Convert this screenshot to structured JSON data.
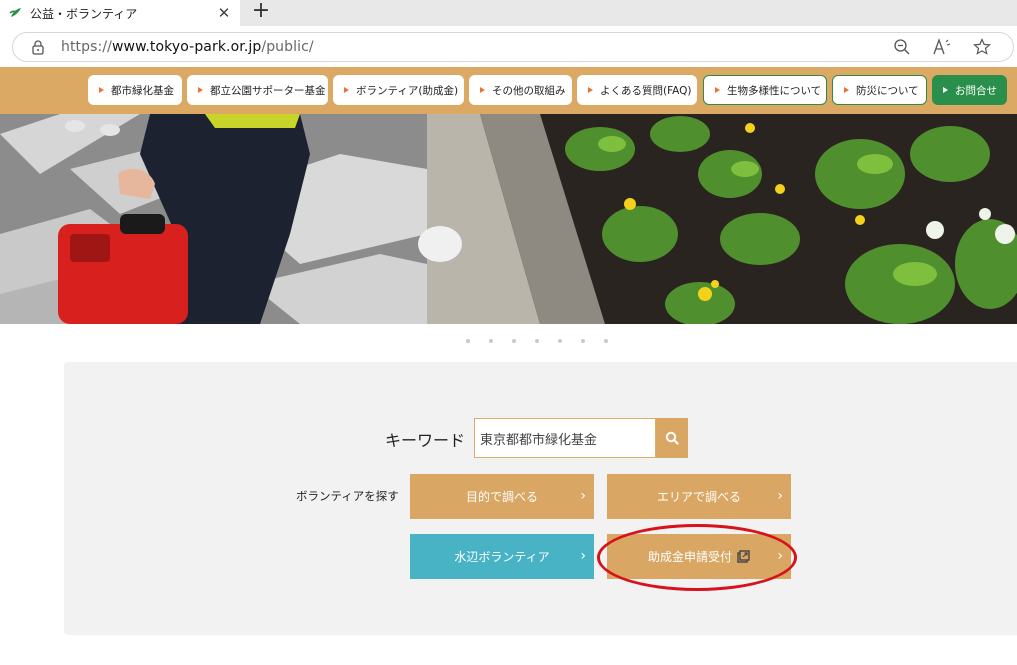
{
  "browser": {
    "tab_title": "公益・ボランティア",
    "tab_close": "✕",
    "new_tab": "+",
    "url_prefix": "https://",
    "url_host": "www.tokyo-park.or.jp",
    "url_path": "/public/",
    "icons": [
      "lock-icon",
      "zoom-out-icon",
      "read-aloud-icon",
      "favorite-star-icon"
    ]
  },
  "nav": {
    "items": [
      {
        "label": "都市緑化基金",
        "style": "white"
      },
      {
        "label": "都立公園サポーター基金",
        "style": "white"
      },
      {
        "label": "ボランティア(助成金)",
        "style": "white"
      },
      {
        "label": "その他の取組み",
        "style": "white"
      },
      {
        "label": "よくある質問(FAQ)",
        "style": "white"
      },
      {
        "label": "生物多様性について",
        "style": "outline-green"
      },
      {
        "label": "防災について",
        "style": "outline-green"
      },
      {
        "label": "お問合せ",
        "style": "green"
      }
    ],
    "colors": {
      "bar": "#dca965",
      "accent_green": "#2a8f4a",
      "triangle": "#e8743b"
    }
  },
  "carousel": {
    "dot_count": 7
  },
  "search": {
    "keyword_label": "キーワード",
    "keyword_value": "東京都都市緑化基金",
    "volunteer_label": "ボランティアを探す",
    "buttons": {
      "by_purpose": "目的で調べる",
      "by_area": "エリアで調べる",
      "waterside": "水辺ボランティア",
      "grant_application": "助成金申請受付"
    },
    "colors": {
      "tan": "#d9a763",
      "teal": "#49b3c6",
      "highlight": "#d8121b"
    }
  }
}
